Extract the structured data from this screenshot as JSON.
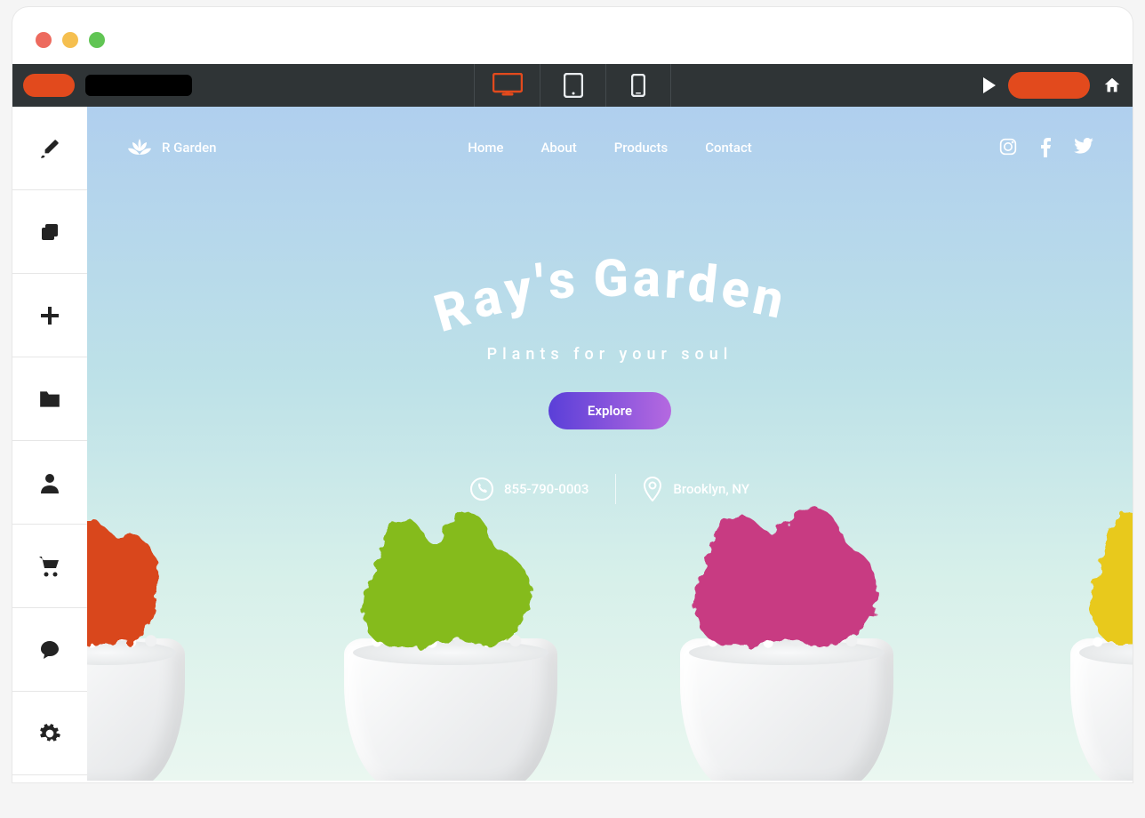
{
  "site": {
    "brand": "R Garden",
    "nav": [
      "Home",
      "About",
      "Products",
      "Contact"
    ],
    "hero_title": "Ray's Garden",
    "hero_subtitle": "Plants for your soul",
    "cta": "Explore",
    "phone": "855-790-0003",
    "location": "Brooklyn, NY"
  },
  "colors": {
    "accent": "#e24a1d",
    "toolbar": "#2f3436",
    "cta_gradient_from": "#5a3fd8",
    "cta_gradient_to": "#b569e0"
  },
  "sidebar_icons": [
    "brush",
    "layers",
    "add",
    "folder",
    "person",
    "cart",
    "chat",
    "settings"
  ],
  "devices": [
    "desktop",
    "tablet",
    "phone"
  ],
  "active_device": "desktop",
  "social": [
    "instagram",
    "facebook",
    "twitter"
  ],
  "plants": [
    {
      "color": "#d9461f"
    },
    {
      "color": "#85bb1e"
    },
    {
      "color": "#c83a82"
    },
    {
      "color": "#e8c91b"
    }
  ]
}
